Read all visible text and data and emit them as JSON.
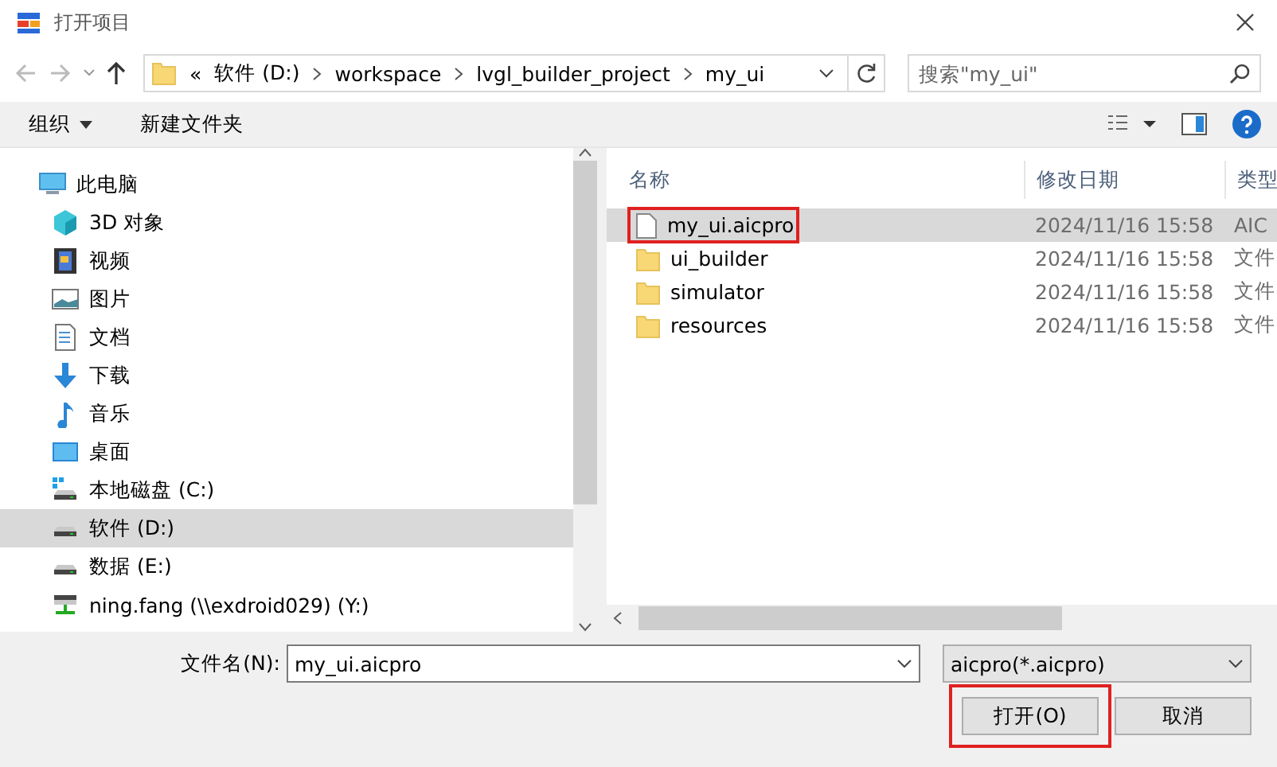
{
  "window": {
    "title": "打开项目"
  },
  "address": {
    "overflow": "«",
    "crumbs": [
      "软件 (D:)",
      "workspace",
      "lvgl_builder_project",
      "my_ui"
    ]
  },
  "search": {
    "placeholder": "搜索\"my_ui\""
  },
  "toolbar": {
    "organize": "组织",
    "new_folder": "新建文件夹"
  },
  "sidebar": {
    "items": [
      {
        "label": "此电脑",
        "kind": "pc",
        "selected": false,
        "children": [
          {
            "label": "3D 对象",
            "kind": "cube",
            "selected": false
          },
          {
            "label": "视频",
            "kind": "video",
            "selected": false
          },
          {
            "label": "图片",
            "kind": "picture",
            "selected": false
          },
          {
            "label": "文档",
            "kind": "document",
            "selected": false
          },
          {
            "label": "下载",
            "kind": "download",
            "selected": false
          },
          {
            "label": "音乐",
            "kind": "music",
            "selected": false
          },
          {
            "label": "桌面",
            "kind": "desktop",
            "selected": false
          },
          {
            "label": "本地磁盘 (C:)",
            "kind": "system-drive",
            "selected": false
          },
          {
            "label": "软件 (D:)",
            "kind": "drive",
            "selected": true
          },
          {
            "label": "数据 (E:)",
            "kind": "drive",
            "selected": false
          },
          {
            "label": "ning.fang (\\\\exdroid029) (Y:)",
            "kind": "network-drive",
            "selected": false
          }
        ]
      }
    ]
  },
  "files": {
    "columns": [
      "名称",
      "修改日期",
      "类型"
    ],
    "rows": [
      {
        "name": "my_ui.aicpro",
        "date": "2024/11/16 15:58",
        "type": "AIC",
        "kind": "file",
        "selected": true,
        "highlighted": true
      },
      {
        "name": "ui_builder",
        "date": "2024/11/16 15:58",
        "type": "文件",
        "kind": "folder",
        "selected": false,
        "highlighted": false
      },
      {
        "name": "simulator",
        "date": "2024/11/16 15:58",
        "type": "文件",
        "kind": "folder",
        "selected": false,
        "highlighted": false
      },
      {
        "name": "resources",
        "date": "2024/11/16 15:58",
        "type": "文件",
        "kind": "folder",
        "selected": false,
        "highlighted": false
      }
    ]
  },
  "footer": {
    "filename_label": "文件名(N):",
    "filename": "my_ui.aicpro",
    "filter": "aicpro(*.aicpro)",
    "buttons": [
      {
        "label": "打开(O)",
        "highlighted": true
      },
      {
        "label": "取消",
        "highlighted": false
      }
    ]
  }
}
